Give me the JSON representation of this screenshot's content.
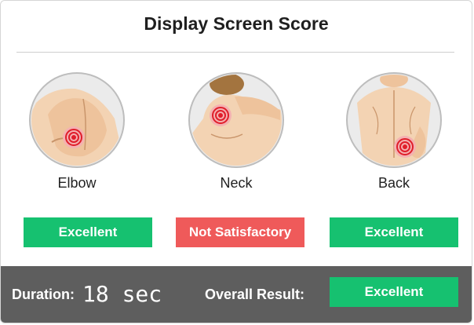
{
  "title": "Display Screen Score",
  "zones": [
    {
      "label": "Elbow",
      "icon": "elbow-pain-icon",
      "result": "Excellent",
      "status": "good"
    },
    {
      "label": "Neck",
      "icon": "neck-pain-icon",
      "result": "Not Satisfactory",
      "status": "bad"
    },
    {
      "label": "Back",
      "icon": "back-pain-icon",
      "result": "Excellent",
      "status": "good"
    }
  ],
  "footer": {
    "duration_label": "Duration:",
    "duration_value": "18 sec",
    "overall_label": "Overall Result:",
    "overall_result": "Excellent"
  },
  "colors": {
    "good": "#16c170",
    "bad": "#ef5a5a",
    "footer_bg": "#5e5e5e",
    "pain": "#e01e2b"
  }
}
